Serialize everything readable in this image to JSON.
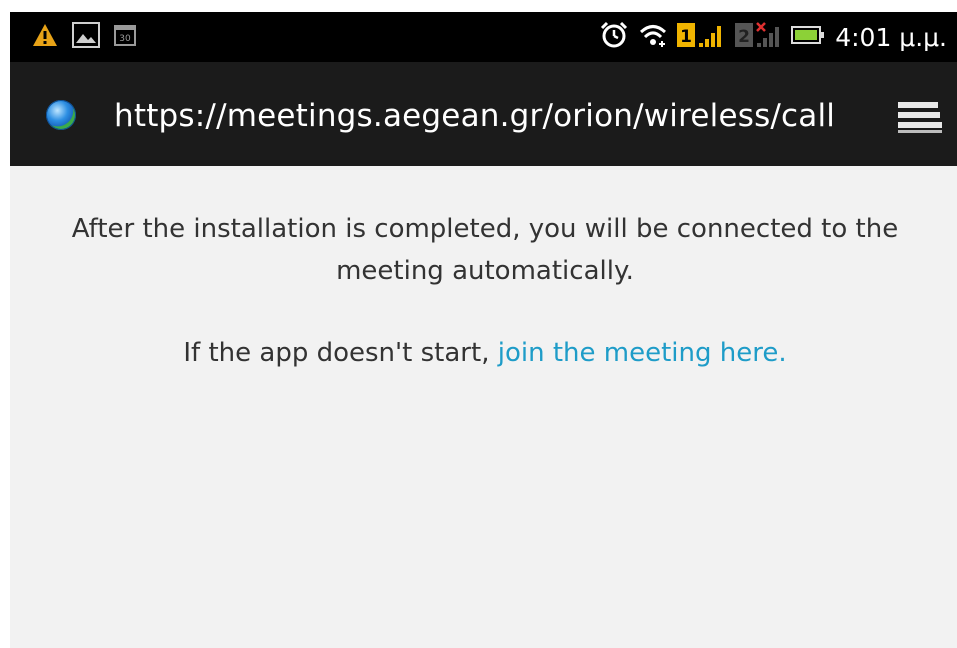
{
  "status_bar": {
    "left_icons": [
      "warning-icon",
      "image-icon",
      "calendar-icon"
    ],
    "right_icons": [
      "alarm-icon",
      "wifi-icon",
      "sim1-signal-icon",
      "sim2-no-signal-icon",
      "battery-icon"
    ],
    "sim1_label": "1",
    "sim2_label": "2",
    "calendar_label": "30",
    "time": "4:01 μ.μ."
  },
  "browser": {
    "url": "https://meetings.aegean.gr/orion/wireless/call",
    "menu_icon": "tabs-menu-icon"
  },
  "page": {
    "message": "After the installation is completed, you will be connected to the meeting automatically.",
    "fallback_prefix": "If the app doesn't start, ",
    "fallback_link": "join the meeting here."
  },
  "colors": {
    "background": "#f2f2f2",
    "toolbar": "#1b1b1b",
    "status_bar": "#000000",
    "link": "#1e9cc8",
    "text": "#333333"
  }
}
